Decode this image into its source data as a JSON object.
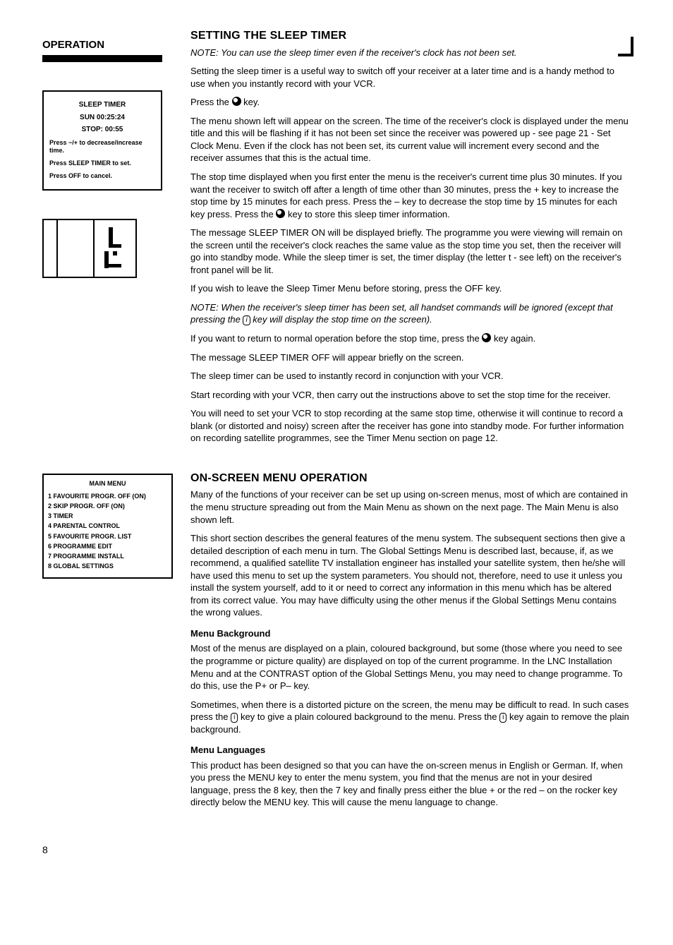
{
  "header": {
    "operation": "OPERATION"
  },
  "corner": true,
  "sleep": {
    "title": "SETTING THE SLEEP TIMER",
    "note": "NOTE: You can use the sleep timer even if the receiver's clock has not been set.",
    "p1": "Setting the sleep timer is a useful way to switch off your receiver at a later time and is a handy method to use when you instantly record with your VCR.",
    "p2a": "Press the ",
    "p2b": " key.",
    "p3": "The menu shown left will appear on the screen. The time of the receiver's clock is displayed under the menu title and this will be flashing if it has not been set since the receiver was powered up - see page 21 - Set Clock Menu. Even if the clock has not been set, its current value will increment every second and the receiver assumes that this is the actual time.",
    "p4a": "The stop time displayed when you first enter the menu is the receiver's current time plus 30 minutes. If you want the receiver to switch off after a length of time other than 30 minutes, press the + key to increase the stop time by 15 minutes for each press. Press the – key to decrease the stop time by 15 minutes for each key press. Press the ",
    "p4b": " key to store this sleep timer information.",
    "p5": "The message SLEEP TIMER ON will be displayed briefly. The programme you were viewing will remain on the screen until the receiver's clock reaches the same value as the stop time you set, then the receiver will go into standby mode. While the sleep timer is set, the timer display (the letter t - see left) on the receiver's front panel will be lit.",
    "p6": "If you wish to leave the Sleep Timer Menu before storing, press the OFF key.",
    "note2a": "NOTE: When the receiver's sleep timer has been set, all handset commands will be ignored (except that pressing the ",
    "note2b": " key will display the stop time on the screen).",
    "p7a": "If you want to return to normal operation before the stop time, press the ",
    "p7b": " key again.",
    "p8": "The message SLEEP TIMER OFF will appear briefly on the screen.",
    "p9": "The sleep timer can be used to instantly record in conjunction with your VCR.",
    "p10": "Start recording with your VCR, then carry out the instructions above to set the stop time for the receiver.",
    "p11": "You will need to set your VCR to stop recording at the same stop time, otherwise it will continue to record a blank (or distorted and noisy) screen after the receiver has gone into standby mode. For further information on recording satellite programmes, see the Timer Menu section on page 12."
  },
  "sleep_menu": {
    "title": "SLEEP TIMER",
    "time": "SUN  00:25:24",
    "stop": "STOP: 00:55",
    "l1": "Press −/+ to decrease/increase time.",
    "l2": "Press SLEEP TIMER to set.",
    "l3": "Press OFF to cancel."
  },
  "onscreen": {
    "title": "ON-SCREEN MENU OPERATION",
    "p1": "Many of the functions of your receiver can be set up using on-screen menus, most of which are contained in the menu structure spreading out from the Main Menu as shown on the next page. The Main Menu is also shown left.",
    "p2": "This short section describes the general features of the menu system. The subsequent sections then give a detailed description of each menu in turn. The Global Settings Menu is described last, because, if, as we recommend, a qualified satellite TV installation engineer has installed your satellite system, then he/she will have used this menu to set up the system parameters. You should not, therefore, need to use it unless you install the system yourself, add to it or need to correct any information in this menu which has be altered from its correct value. You may have difficulty using the other menus if the Global Settings Menu contains the wrong values.",
    "bg_head": "Menu Background",
    "bg_p1": "Most of the menus are displayed on a plain, coloured background, but some (those where you need to see the programme or picture quality) are displayed on top of the current programme. In the LNC Installation Menu and at the CONTRAST option of the Global Settings Menu, you may need to change programme. To do this, use the P+ or P– key.",
    "bg_p2a": "Sometimes, when there is a distorted picture on the screen, the menu may be difficult to read. In such cases press the ",
    "bg_p2b": " key to give a plain coloured background to the menu. Press the ",
    "bg_p2c": " key again to remove the plain background.",
    "lang_head": "Menu Languages",
    "lang_p": "This product has been designed so that you can have the on-screen menus in English or German. If, when you press the MENU key to enter the menu system, you find that the menus are not in your desired language, press the 8 key, then the 7 key and finally press either the blue + or the red – on the rocker key directly below the MENU key. This will cause the menu language to change."
  },
  "main_menu": {
    "title": "MAIN MENU",
    "items": [
      "1  FAVOURITE PROGR. OFF (ON)",
      "2  SKIP PROGR. OFF (ON)",
      "3  TIMER",
      "4  PARENTAL CONTROL",
      "5  FAVOURITE PROGR. LIST",
      "6  PROGRAMME EDIT",
      "7  PROGRAMME INSTALL",
      "8  GLOBAL SETTINGS"
    ]
  },
  "key_i": "i",
  "page": "8"
}
